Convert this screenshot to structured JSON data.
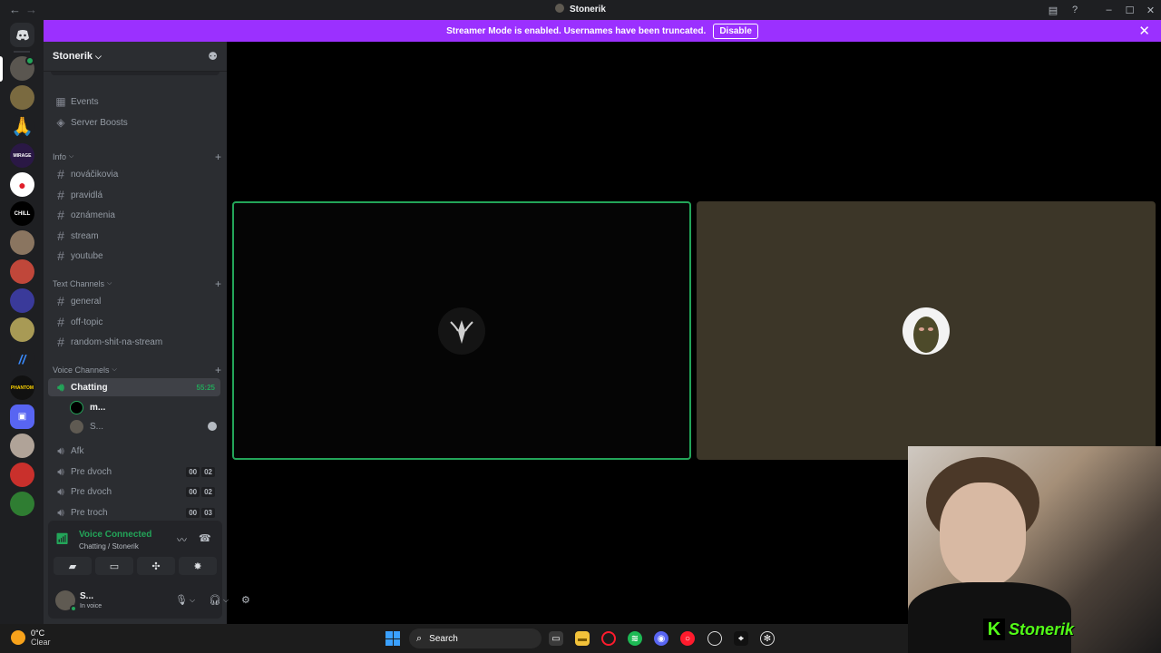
{
  "window": {
    "title": "Stonerik",
    "back_icon": "←",
    "forward_icon": "→"
  },
  "banner": {
    "message": "Streamer Mode is enabled. Usernames have been truncated.",
    "disable_label": "Disable"
  },
  "server": {
    "name": "Stonerik"
  },
  "sidebar": {
    "top_items": [
      {
        "label": "Events",
        "icon": "calendar-icon"
      },
      {
        "label": "Server Boosts",
        "icon": "boost-icon"
      }
    ],
    "info_category": "Info",
    "info_channels": [
      "nováčikovia",
      "pravidlá",
      "oznámenia",
      "stream",
      "youtube"
    ],
    "text_category": "Text Channels",
    "text_channels": [
      "general",
      "off-topic",
      "random-shit-na-stream"
    ],
    "voice_category": "Voice Channels",
    "active_voice": {
      "label": "Chatting",
      "timer": "55:25"
    },
    "voice_users": [
      "m...",
      "S..."
    ],
    "other_voice": [
      {
        "label": "Afk"
      },
      {
        "label": "Pre dvoch",
        "counts": [
          "00",
          "02"
        ]
      },
      {
        "label": "Pre dvoch",
        "counts": [
          "00",
          "02"
        ]
      },
      {
        "label": "Pre troch",
        "counts": [
          "00",
          "03"
        ]
      }
    ]
  },
  "voice_panel": {
    "title": "Voice Connected",
    "subtitle": "Chatting / Stonerik"
  },
  "user_panel": {
    "name": "S...",
    "status": "In voice"
  },
  "overlay": {
    "brand_letter": "K",
    "brand_text": "Stonerik"
  },
  "taskbar": {
    "temperature": "0°C",
    "condition": "Clear",
    "search_placeholder": "Search"
  },
  "colors": {
    "banner": "#9b30ff",
    "connected_green": "#23a559",
    "sidebar": "#2b2d31",
    "rail": "#1e1f22"
  }
}
